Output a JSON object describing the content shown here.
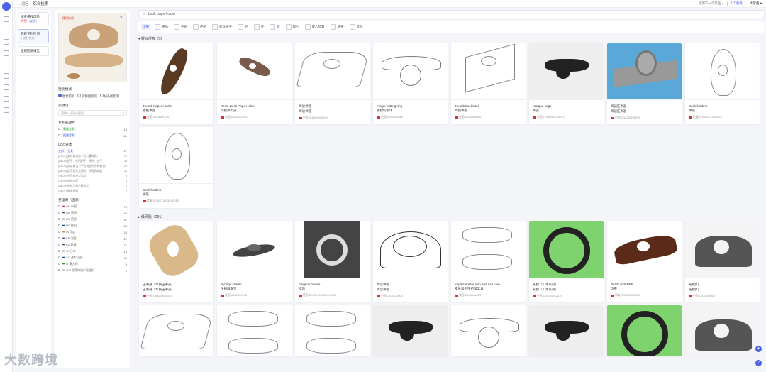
{
  "topbar": {
    "back_label": "← 返回",
    "title": "综合检索",
    "next_label": "检测下一个产品 ›",
    "service_label": "人工服务",
    "user_label": "大掌柜 ▾"
  },
  "tasks": [
    {
      "title": "排查侵权风险",
      "sub": "失败",
      "badge": "● 0"
    },
    {
      "title": "外观专利检测",
      "sub": "● 进行检测"
    },
    {
      "title": "生成检测报告",
      "sub": ""
    }
  ],
  "filters": {
    "query_image_tag": "侵权检测",
    "query_image_caption1": "Thumb Page Holder",
    "query_image_caption2": "Reading Tool",
    "mode_label": "检测模式",
    "modes": [
      "图像检测",
      "实物图检测",
      "线条图检测"
    ],
    "keyword_label": "关键词",
    "keyword_placeholder": "请输入检测关键词",
    "patent_type_label": "专利有效性",
    "patent_types": [
      {
        "label": "有效专利",
        "count": "118"
      },
      {
        "label": "失效专利",
        "count": "181"
      }
    ],
    "locarno_label": "LOC分类",
    "locarno_tabs": [
      "全部",
      "分类"
    ],
    "locarno_count": "17",
    "locarno_rows": [
      {
        "text": "[21-01] 游戏和类似（含儿童玩具）",
        "count": "72"
      },
      {
        "text": "[08-06] 把手、捏柄把手、把柄、扶手",
        "count": "35"
      },
      {
        "text": "[03-03] 类似箱包（不含前述的所有箱包）",
        "count": "24"
      },
      {
        "text": "[26-04] 用于灯光光源的，护理和美容",
        "count": "21"
      },
      {
        "text": "[19-02] 书写和办公用品",
        "count": "9"
      },
      {
        "text": "[19-99] 其他杂项",
        "count": "8"
      },
      {
        "text": "[28-03] 化妆品和护理用品",
        "count": "6"
      },
      {
        "text": "[19-07] 教学材料",
        "count": "5"
      }
    ],
    "country_label": "受理局（国家）",
    "countries": [
      {
        "code": "CN 中国",
        "count": "73"
      },
      {
        "code": "GB 英国",
        "count": "43"
      },
      {
        "code": "DE 德国",
        "count": "42"
      },
      {
        "code": "US 美国",
        "count": "38"
      },
      {
        "code": "IN 印度",
        "count": "24"
      },
      {
        "code": "FR 法国",
        "count": "22"
      },
      {
        "code": "EU 欧盟",
        "count": "15"
      },
      {
        "code": "JP 日本",
        "count": "14"
      },
      {
        "code": "AU 澳大利亚",
        "count": "11"
      },
      {
        "code": "IT 意大利",
        "count": "8"
      },
      {
        "code": "WO 世界知识产权组织",
        "count": "2"
      }
    ]
  },
  "search": {
    "query": "book page holder"
  },
  "categories": [
    "全部",
    "戒指",
    "手柄",
    "把手",
    "家具把手",
    "杯",
    "夹",
    "钩",
    "镜片",
    "成人装置",
    "纸夹",
    "其他"
  ],
  "groups": [
    {
      "label": "疑似侵权",
      "count": "（9）"
    },
    {
      "label": "低风险",
      "count": "（291）"
    }
  ],
  "group1": [
    {
      "t1": "Thumb Paper Holder",
      "t2": "捏板书签",
      "meta": "美国  US6519872S"
    },
    {
      "t1": "Resin Book Page Holder",
      "t2": "树脂书页夹",
      "meta": "美国  US6254020S"
    },
    {
      "t1": "阅读书签",
      "t2": "阅读书签",
      "meta": "中国  CN305958924S"
    },
    {
      "t1": "Finger cutting ring",
      "t2": "手指切割环",
      "meta": "美国  US0068981S"
    },
    {
      "t1": "Thumb bookmark",
      "t2": "拇指书签",
      "meta": "美国  US0590886S"
    },
    {
      "t1": "Marque-page",
      "t2": "书签",
      "meta": "法国  FR695035-0001S"
    },
    {
      "t1": "阅读压书器",
      "t2": "阅读压书器",
      "meta": "中国  CN305529899S"
    },
    {
      "t1": "Book holders",
      "t2": "书签",
      "meta": "欧盟  EU9082718-0001S"
    }
  ],
  "group1b": [
    {
      "t1": "Book holders",
      "t2": "书签",
      "meta": "欧盟  EU002738039-0001S"
    }
  ],
  "group2": [
    {
      "t1": "压书器（木质压书夹）",
      "t2": "压书器（木质压书夹）",
      "meta": "中国  CN305962937S"
    },
    {
      "t1": "Syringe Holder",
      "t2": "注射器支架",
      "meta": "美国  US6286490S"
    },
    {
      "t1": "Fingerschmuck",
      "t2": "指饰",
      "meta": "德国  DE4901660001-0006S"
    },
    {
      "t1": "阅读书签",
      "t2": "阅读书签",
      "meta": "中国  CN3011060S"
    },
    {
      "t1": "Implement for skin and nail care",
      "t2": "皮肤和指甲护理工具",
      "meta": "美国  US0444845S"
    },
    {
      "t1": "戒指（山水系列）",
      "t2": "戒指（山水系列）",
      "meta": "中国  CN305791227S"
    },
    {
      "t1": "PAGE HOLDER",
      "t2": "页夹",
      "meta": "印度  IN331966-0015"
    },
    {
      "t1": "戒指(1)",
      "t2": "戒指(1)",
      "meta": "中国  CN30546905"
    }
  ],
  "watermark": "大数跨境",
  "colors": {
    "accent": "#4a63e7"
  }
}
